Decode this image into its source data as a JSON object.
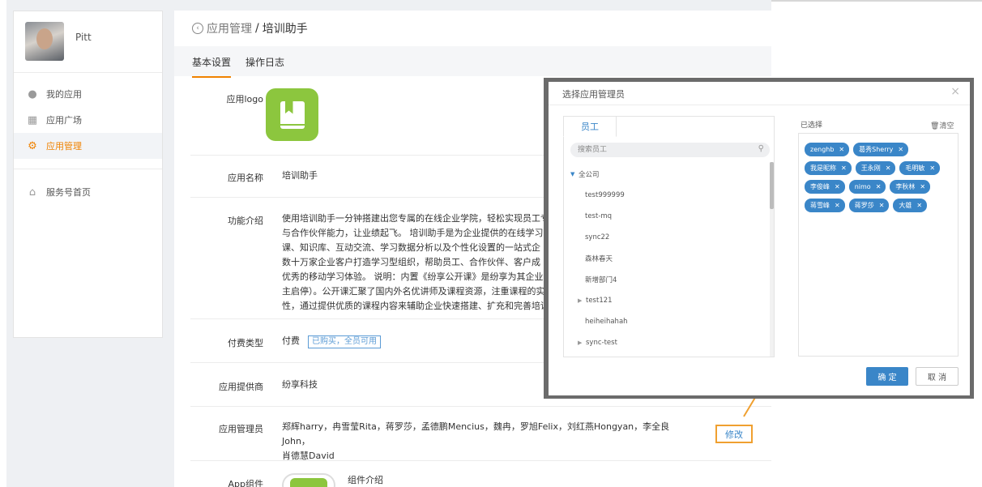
{
  "user": {
    "name": "Pitt"
  },
  "sidebar": {
    "items": [
      {
        "label": "我的应用",
        "icon": "user-icon"
      },
      {
        "label": "应用广场",
        "icon": "grid-icon"
      },
      {
        "label": "应用管理",
        "icon": "gear-icon",
        "active": true
      },
      {
        "label": "服务号首页",
        "icon": "home-icon"
      }
    ]
  },
  "breadcrumb": {
    "parent": "应用管理",
    "separator": "/",
    "current": "培训助手"
  },
  "tabs": [
    {
      "label": "基本设置",
      "active": true
    },
    {
      "label": "操作日志"
    }
  ],
  "details": {
    "logo_label": "应用logo",
    "name_label": "应用名称",
    "name_value": "培训助手",
    "intro_label": "功能介绍",
    "intro_lines": [
      "使用培训助手一分钟搭建出您专属的在线企业学院，轻松实现员工专",
      "与合作伙伴能力，让业绩起飞。 培训助手是为企业提供的在线学习",
      "课、知识库、互动交流、学习数据分析以及个性化设置的一站式企",
      "数十万家企业客户打造学习型组织，帮助员工、合作伙伴、客户成",
      "优秀的移动学习体验。 说明：内置《纷享公开课》是纷享为其企业",
      "主启停）。公开课汇聚了国内外名优讲师及课程资源，注重课程的实",
      "性，通过提供优质的课程内容来辅助企业快速搭建、扩充和完善培训"
    ],
    "pay_label": "付费类型",
    "pay_value": "付费",
    "pay_badge": "已购买，全员可用",
    "provider_label": "应用提供商",
    "provider_value": "纷享科技",
    "admin_label": "应用管理员",
    "admin_line1": "郑辉harry，冉雪莹Rita，蒋罗莎，孟德鹏Mencius，魏冉，罗旭Felix，刘红燕Hongyan，李全良John，",
    "admin_line2": "肖德慧David",
    "modify_label": "修改",
    "app_component_label": "App组件",
    "component_intro_label": "组件介绍"
  },
  "modal": {
    "title": "选择应用管理员",
    "close_icon": "close-icon",
    "employee_tab": "员工",
    "search_placeholder": "搜索员工",
    "tree": [
      {
        "label": "全公司",
        "expanded": true,
        "has_children": true
      },
      {
        "label": "test999999"
      },
      {
        "label": "test-mq"
      },
      {
        "label": "sync22"
      },
      {
        "label": "森林春天"
      },
      {
        "label": "新增部门4"
      },
      {
        "label": "test121",
        "has_children": true
      },
      {
        "label": "heiheihahah"
      },
      {
        "label": "sync-test",
        "has_children": true
      }
    ],
    "selected_label": "已选择",
    "clear_label": "清空",
    "selected": [
      "zenghb",
      "葛秀Sherry",
      "我是昵称",
      "王永刚",
      "毛明敏",
      "李俊峰",
      "nimo",
      "李秋林",
      "蒋雪峰",
      "蒋罗莎",
      "大雄"
    ],
    "ok_label": "确 定",
    "cancel_label": "取 消"
  },
  "colors": {
    "accent": "#f08200",
    "primary": "#3a86c8",
    "logo_green": "#8cc63e"
  }
}
